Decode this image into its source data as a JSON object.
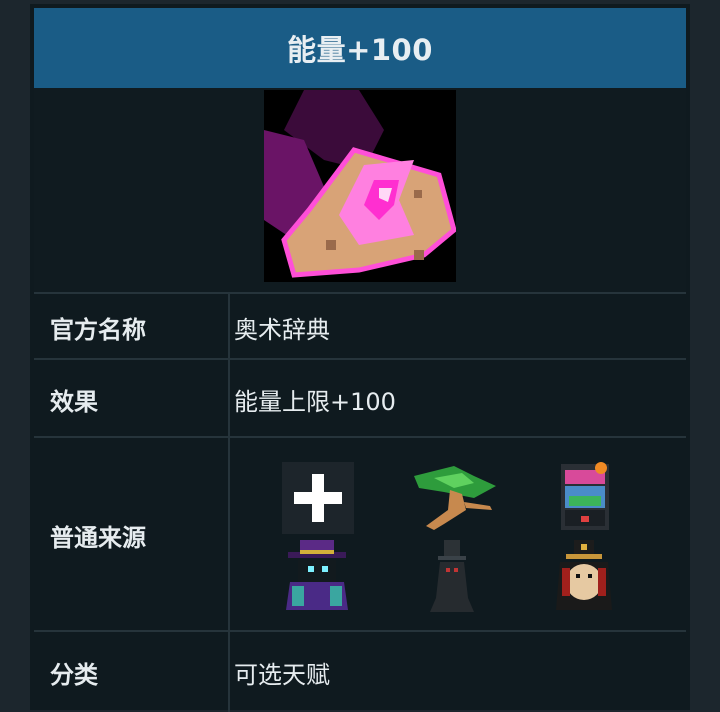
{
  "header": {
    "title": "能量+100"
  },
  "rows": {
    "official_name": {
      "label": "官方名称",
      "value": "奥术辞典"
    },
    "effect": {
      "label": "效果",
      "value": "能量上限+100"
    },
    "sources": {
      "label": "普通来源",
      "icons": [
        "plus-icon",
        "bonsai-tree-icon",
        "arcade-machine-icon",
        "purple-hat-wizard-icon",
        "dark-top-hat-ghost-icon",
        "top-hat-hamster-merchant-icon"
      ]
    },
    "category": {
      "label": "分类",
      "value": "可选天赋"
    }
  },
  "colors": {
    "header_bg": "#1a5c86",
    "panel_bg": "#0f1a1f",
    "text": "#e6ecef"
  },
  "item_icon": "pink-arcane-scroll-icon"
}
